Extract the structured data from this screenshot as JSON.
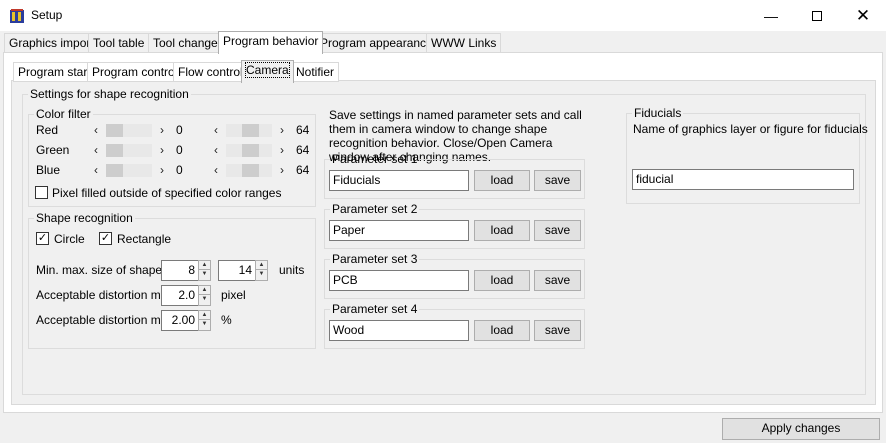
{
  "window": {
    "title": "Setup"
  },
  "main_tabs": [
    "Graphics import",
    "Tool table",
    "Tool change",
    "Program behavior",
    "Program appearance",
    "WWW Links"
  ],
  "sub_tabs": [
    "Program start",
    "Program control",
    "Flow control",
    "Camera",
    "Notifier"
  ],
  "shape_section": {
    "title": "Settings for shape recognition"
  },
  "color_filter": {
    "title": "Color filter",
    "rows": [
      {
        "label": "Red",
        "min": "0",
        "max": "64",
        "min_level": 0,
        "max_level": 0.25
      },
      {
        "label": "Green",
        "min": "0",
        "max": "64",
        "min_level": 0,
        "max_level": 0.25
      },
      {
        "label": "Blue",
        "min": "0",
        "max": "64",
        "min_level": 0,
        "max_level": 0.25
      }
    ],
    "outside_checkbox_label": "Pixel filled outside of specified color ranges",
    "outside_checked": false
  },
  "shape_recognition": {
    "title": "Shape recognition",
    "circle_label": "Circle",
    "circle_checked": true,
    "rectangle_label": "Rectangle",
    "rectangle_checked": true,
    "size_label": "Min. max. size of shape",
    "size_min": "8",
    "size_max": "14",
    "size_unit": "units",
    "dist_min_label": "Acceptable distortion min.",
    "dist_min": "2.0",
    "dist_min_unit": "pixel",
    "dist_max_label": "Acceptable distortion max.",
    "dist_max": "2.00",
    "dist_max_unit": "%"
  },
  "param_info": "Save settings in named parameter sets and call them in camera window to change shape recognition behavior. Close/Open Camera window after changing names.",
  "param_sets": [
    {
      "title": "Parameter set 1",
      "value": "Fiducials"
    },
    {
      "title": "Parameter set 2",
      "value": "Paper"
    },
    {
      "title": "Parameter set 3",
      "value": "PCB"
    },
    {
      "title": "Parameter set 4",
      "value": "Wood"
    }
  ],
  "load_label": "load",
  "save_label": "save",
  "fiducials": {
    "title": "Fiducials",
    "description": "Name of graphics layer or figure for fiducials",
    "value": "fiducial"
  },
  "apply_label": "Apply changes",
  "icons": {
    "minimize": "minimize-icon",
    "maximize": "maximize-icon",
    "close": "close-icon",
    "app": "cnc-app-icon"
  }
}
